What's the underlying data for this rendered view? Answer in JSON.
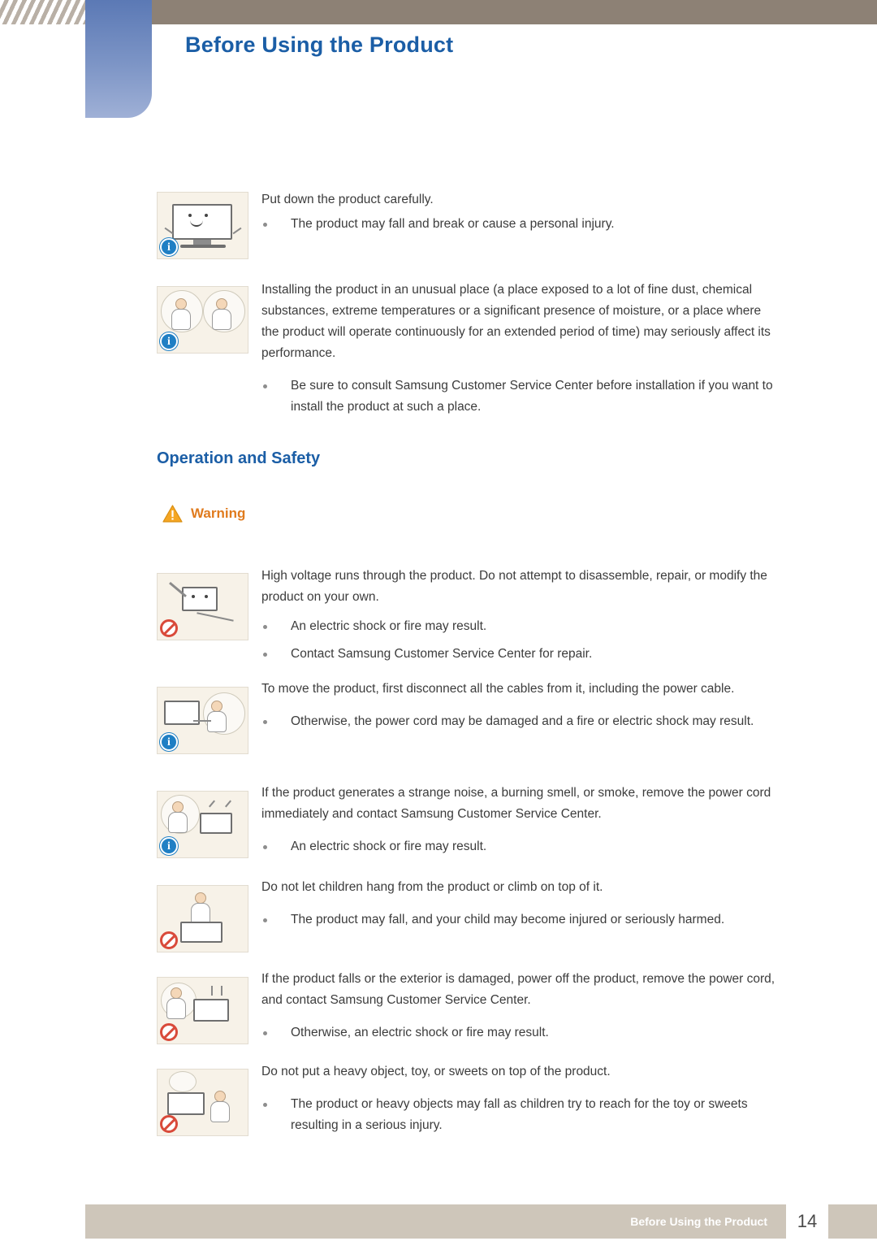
{
  "header": {
    "title": "Before Using the Product"
  },
  "sections": {
    "installation_notes": [
      {
        "icon": "monitor-put-down-illustration",
        "badge": "info-badge",
        "paragraph": "Put down the product carefully.",
        "bullets": [
          "The product may fall and break or cause a personal injury."
        ]
      },
      {
        "icon": "people-unusual-place-illustration",
        "badge": "info-badge",
        "paragraph": "Installing the product in an unusual place (a place exposed to a lot of fine dust, chemical substances, extreme temperatures or a significant presence of moisture, or a place where the product will operate continuously for an extended period of time) may seriously affect its performance.",
        "bullets": [
          "Be sure to consult Samsung Customer Service Center before installation if you want to install the product at such a place."
        ]
      }
    ],
    "operation_heading": "Operation and Safety",
    "warning_label": "Warning",
    "warnings": [
      {
        "icon": "disassemble-product-illustration",
        "badge": "forbidden-badge",
        "paragraph": "High voltage runs through the product. Do not attempt to disassemble, repair, or modify the product on your own.",
        "bullets": [
          "An electric shock or fire may result.",
          "Contact Samsung Customer Service Center for repair."
        ]
      },
      {
        "icon": "disconnect-cables-illustration",
        "badge": "info-badge",
        "paragraph": "To move the product, first disconnect all the cables from it, including the power cable.",
        "bullets": [
          "Otherwise, the power cord may be damaged and a fire or electric shock may result."
        ]
      },
      {
        "icon": "strange-noise-smoke-illustration",
        "badge": "info-badge",
        "paragraph": "If the product generates a strange noise, a burning smell, or smoke, remove the power cord immediately and contact Samsung Customer Service Center.",
        "bullets": [
          "An electric shock or fire may result."
        ]
      },
      {
        "icon": "children-hanging-illustration",
        "badge": "forbidden-badge",
        "paragraph": "Do not let children hang from the product or climb on top of it.",
        "bullets": [
          "The product may fall, and your child may become injured or seriously harmed."
        ]
      },
      {
        "icon": "product-falls-damaged-illustration",
        "badge": "forbidden-badge",
        "paragraph": "If the product falls or the exterior is damaged, power off the product, remove the power cord, and contact Samsung Customer Service Center.",
        "bullets": [
          "Otherwise, an electric shock or fire may result."
        ]
      },
      {
        "icon": "heavy-object-on-product-illustration",
        "badge": "forbidden-badge",
        "paragraph": "Do not put a heavy object, toy, or sweets on top of the product.",
        "bullets": [
          "The product or heavy objects may fall as children try to reach for the toy or sweets resulting in a serious injury."
        ]
      }
    ]
  },
  "footer": {
    "label": "Before Using the Product",
    "page_number": "14"
  }
}
